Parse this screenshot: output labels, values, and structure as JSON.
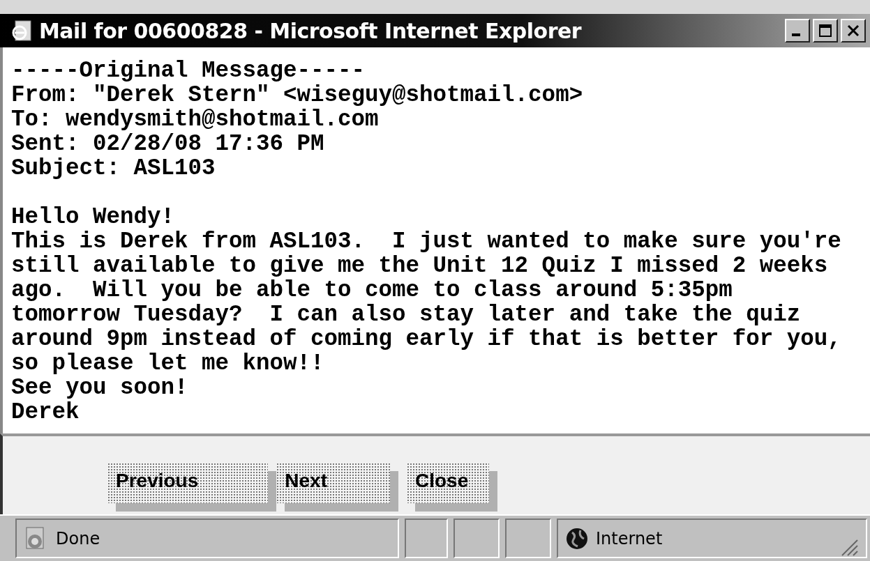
{
  "window": {
    "title": "Mail for 00600828 - Microsoft Internet Explorer"
  },
  "message": {
    "header_lines": [
      "-----Original Message-----",
      "From: \"Derek Stern\" <wiseguy@shotmail.com>",
      "To: wendysmith@shotmail.com",
      "Sent: 02/28/08 17:36 PM",
      "Subject: ASL103"
    ],
    "body_lines": [
      "Hello Wendy!",
      "This is Derek from ASL103.  I just wanted to make sure you're",
      "still available to give me the Unit 12 Quiz I missed 2 weeks",
      "ago.  Will you be able to come to class around 5:35pm",
      "tomorrow Tuesday?  I can also stay later and take the quiz",
      "around 9pm instead of coming early if that is better for you,",
      "so please let me know!!",
      "See you soon!",
      "Derek"
    ]
  },
  "buttons": [
    "Previous",
    "Next",
    "Close"
  ],
  "status_bar": {
    "text": "Done",
    "zone": "Internet"
  }
}
